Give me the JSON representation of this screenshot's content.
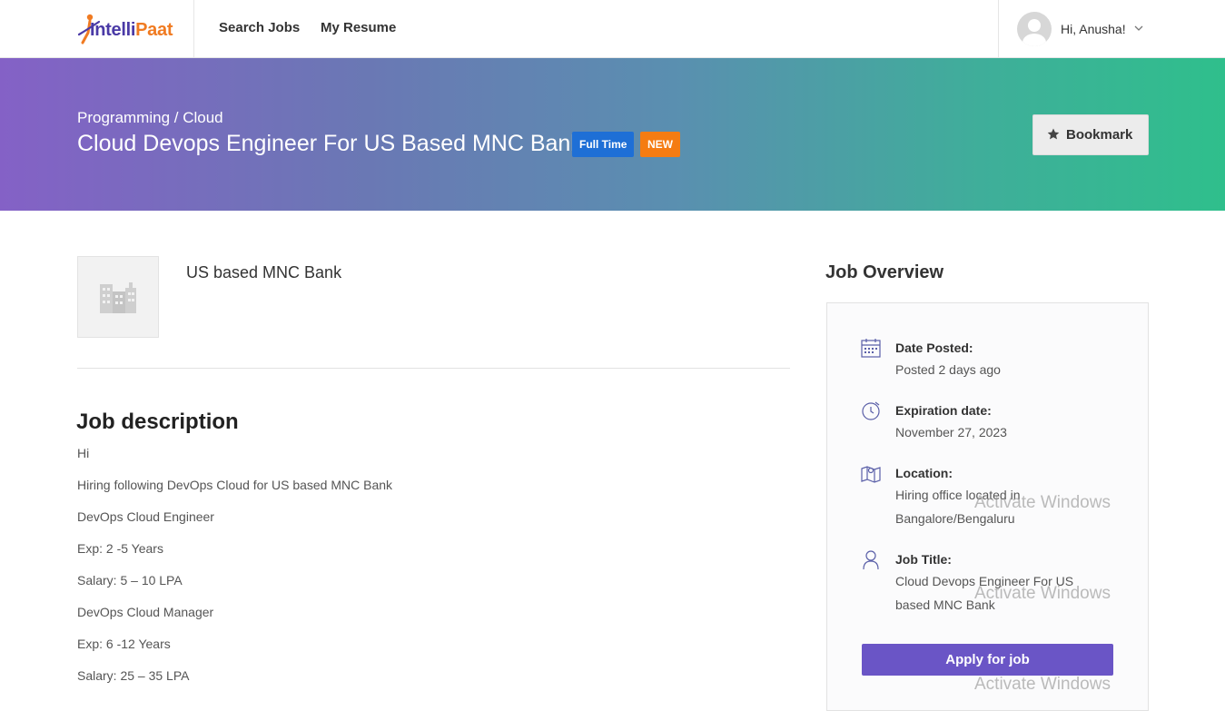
{
  "brand": {
    "logo_part1": "Intelli",
    "logo_part2": "Paat"
  },
  "nav": {
    "search_jobs": "Search Jobs",
    "my_resume": "My Resume"
  },
  "user": {
    "greeting": "Hi, Anusha!"
  },
  "hero": {
    "breadcrumb": "Programming / Cloud",
    "title": "Cloud Devops Engineer For US Based MNC Bank",
    "badge_type": "Full Time",
    "badge_new": "NEW",
    "bookmark_label": "Bookmark"
  },
  "company": {
    "name": "US based MNC Bank"
  },
  "description": {
    "heading": "Job description",
    "lines": [
      "Hi",
      "Hiring following DevOps Cloud for US based MNC Bank",
      "DevOps Cloud Engineer",
      "Exp: 2 -5 Years",
      "Salary: 5 – 10 LPA",
      "DevOps Cloud Manager",
      "Exp: 6 -12 Years",
      "Salary: 25 – 35 LPA"
    ]
  },
  "overview": {
    "heading": "Job Overview",
    "items": [
      {
        "icon": "calendar-icon",
        "label": "Date Posted:",
        "value": "Posted 2 days ago"
      },
      {
        "icon": "clock-icon",
        "label": "Expiration date:",
        "value": "November 27, 2023"
      },
      {
        "icon": "map-icon",
        "label": "Location:",
        "value": "Hiring office located in Bangalore/Bengaluru"
      },
      {
        "icon": "person-icon",
        "label": "Job Title:",
        "value": "Cloud Devops Engineer For US based MNC Bank"
      }
    ],
    "apply_label": "Apply for job"
  },
  "watermark": "Activate Windows",
  "colors": {
    "accent": "#6a55c6",
    "badge_blue": "#1e6fd6",
    "badge_orange": "#f57c12"
  }
}
